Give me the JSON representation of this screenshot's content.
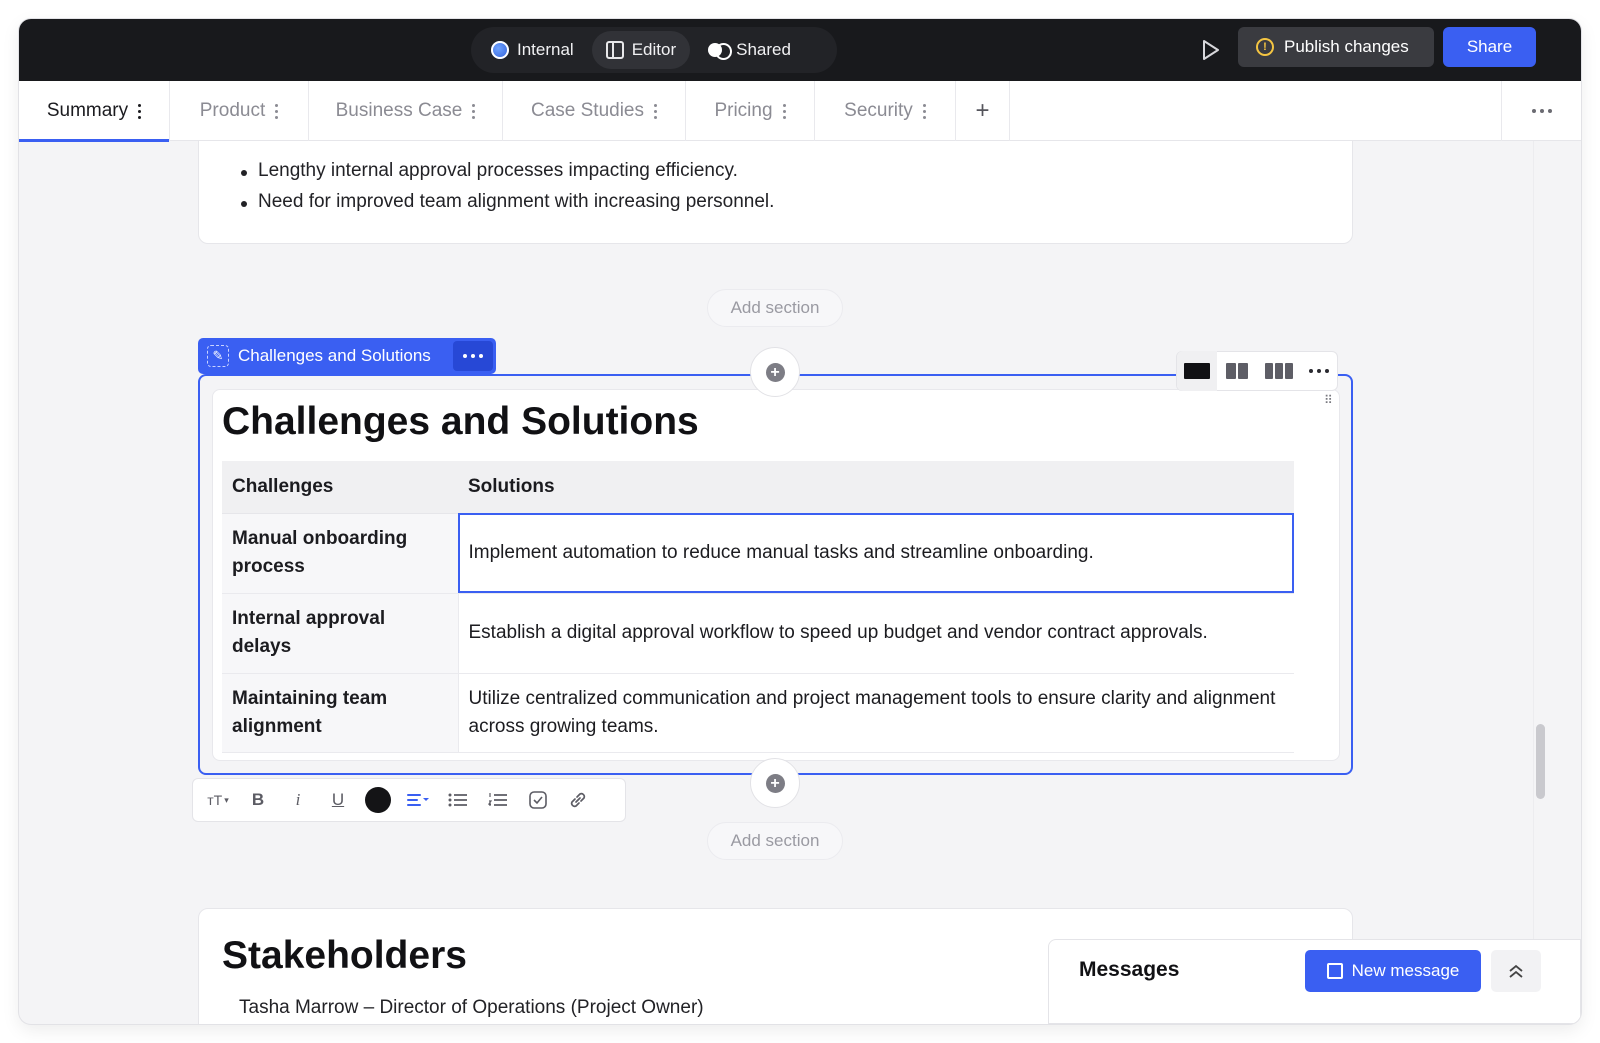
{
  "topbar": {
    "modes": [
      {
        "label": "Internal",
        "icon": "globe-icon"
      },
      {
        "label": "Editor",
        "icon": "panel-icon"
      },
      {
        "label": "Shared",
        "icon": "toggle-icon"
      }
    ],
    "active_mode": "Editor",
    "publish_label": "Publish changes",
    "share_label": "Share"
  },
  "tabs": [
    {
      "label": "Summary",
      "active": true
    },
    {
      "label": "Product"
    },
    {
      "label": "Business Case"
    },
    {
      "label": "Case Studies"
    },
    {
      "label": "Pricing"
    },
    {
      "label": "Security"
    }
  ],
  "previous_section": {
    "bullets": [
      "Lengthy internal approval processes impacting efficiency.",
      "Need for improved team alignment with increasing personnel."
    ]
  },
  "add_section_label": "Add section",
  "current_section": {
    "pill_label": "Challenges and Solutions",
    "title": "Challenges and Solutions",
    "table": {
      "headers": [
        "Challenges",
        "Solutions"
      ],
      "rows": [
        {
          "challenge": "Manual onboarding process",
          "solution": "Implement automation to reduce manual tasks and streamline onboarding."
        },
        {
          "challenge": "Internal approval delays",
          "solution": "Establish a digital approval workflow to speed up budget and vendor contract approvals."
        },
        {
          "challenge": "Maintaining team alignment",
          "solution": "Utilize centralized communication and project management tools to ensure clarity and alignment across growing teams."
        }
      ]
    }
  },
  "formatting": {
    "text_size_label": "тT",
    "bold_label": "B",
    "italic_label": "i",
    "underline_label": "U",
    "color": "#141416"
  },
  "next_section": {
    "title": "Stakeholders",
    "first_line": "Tasha Marrow – Director of Operations (Project Owner)"
  },
  "messages": {
    "title": "Messages",
    "new_message_label": "New message"
  },
  "colors": {
    "accent": "#3a5ff2",
    "topbar": "#18191c",
    "warning": "#f4c542"
  }
}
